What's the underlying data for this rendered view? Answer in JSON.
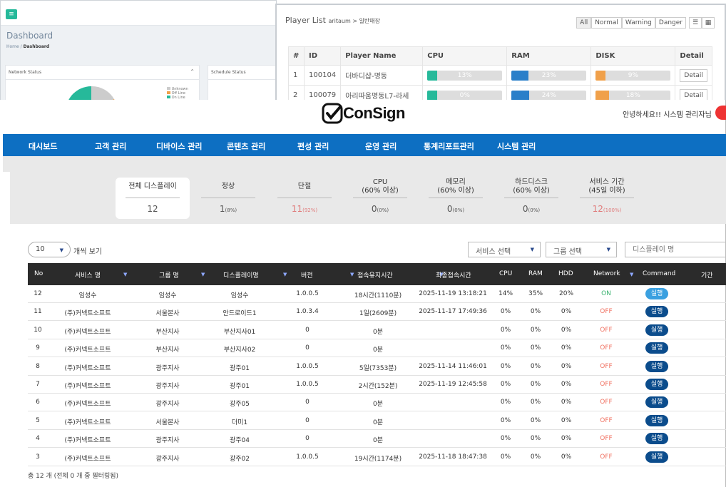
{
  "bg_dashboard": {
    "title": "Dashboard",
    "crumb_home": "Home",
    "crumb_sep": "/",
    "crumb_current": "Dashboard",
    "network_panel": "Network Status",
    "schedule_panel": "Schedule Status",
    "legend": [
      "Unknown",
      "Off Line",
      "On Line"
    ]
  },
  "bg_player": {
    "title": "Player List",
    "breadcrumb": "aritaum > 일반매장",
    "filters": [
      "All",
      "Normal",
      "Warning",
      "Danger"
    ],
    "columns": [
      "#",
      "ID",
      "Player Name",
      "CPU",
      "RAM",
      "DISK",
      "Detail"
    ],
    "rows": [
      {
        "n": "1",
        "id": "100104",
        "name": "더바디샵-명동",
        "cpu": "13%",
        "cpu_v": 13,
        "ram": "23%",
        "ram_v": 23,
        "disk": "9%",
        "disk_v": 9,
        "detail": "Detail"
      },
      {
        "n": "2",
        "id": "100079",
        "name": "아리따움명동L7-라세",
        "cpu": "0%",
        "cpu_v": 0,
        "ram": "24%",
        "ram_v": 24,
        "disk": "18%",
        "disk_v": 18,
        "detail": "Detail"
      }
    ]
  },
  "header": {
    "logo": "ConSign",
    "greeting": "안녕하세요!! 시스템 관리자님"
  },
  "nav": [
    "대시보드",
    "고객 관리",
    "디바이스 관리",
    "콘텐츠 관리",
    "편성 관리",
    "운영 관리",
    "통계리포트관리",
    "시스템 관리"
  ],
  "cards": [
    {
      "title": "전체 디스플레이",
      "value": "12",
      "pct": ""
    },
    {
      "title": "정상",
      "value": "1",
      "pct": "(8%)"
    },
    {
      "title": "단절",
      "value": "11",
      "pct": "(92%)"
    },
    {
      "title": "CPU\n(60% 이상)",
      "value": "0",
      "pct": "(0%)"
    },
    {
      "title": "메모리\n(60% 이상)",
      "value": "0",
      "pct": "(0%)"
    },
    {
      "title": "하드디스크\n(60% 이상)",
      "value": "0",
      "pct": "(0%)"
    },
    {
      "title": "서비스 기간\n(45일 이하)",
      "value": "12",
      "pct": "(100%)"
    }
  ],
  "controls": {
    "page_size": "10",
    "page_size_label": "개씩 보기",
    "service_select": "서비스 선택",
    "group_select": "그룹 선택",
    "search_placeholder": "디스플레이 명"
  },
  "table": {
    "columns": [
      "No",
      "서비스 명",
      "그룹 명",
      "디스플레이명",
      "버전",
      "접속유지시간",
      "최종접속시간",
      "CPU",
      "RAM",
      "HDD",
      "Network",
      "Command",
      "기간"
    ],
    "rows": [
      {
        "no": "12",
        "service": "임성수",
        "group": "임성수",
        "display": "임성수",
        "version": "1.0.0.5",
        "uptime": "18시간(1110분)",
        "last": "2025-11-19 13:18:21",
        "cpu": "14%",
        "ram": "35%",
        "hdd": "20%",
        "net": "ON",
        "cmd": "실행"
      },
      {
        "no": "11",
        "service": "(주)커넥트소프트",
        "group": "서울본사",
        "display": "안드로이드1",
        "version": "1.0.3.4",
        "uptime": "1일(2609분)",
        "last": "2025-11-17 17:49:36",
        "cpu": "0%",
        "ram": "0%",
        "hdd": "0%",
        "net": "OFF",
        "cmd": "실행"
      },
      {
        "no": "10",
        "service": "(주)커넥트소프트",
        "group": "부산지사",
        "display": "부산지사01",
        "version": "0",
        "uptime": "0분",
        "last": "",
        "cpu": "0%",
        "ram": "0%",
        "hdd": "0%",
        "net": "OFF",
        "cmd": "실행"
      },
      {
        "no": "9",
        "service": "(주)커넥트소프트",
        "group": "부산지사",
        "display": "부산지사02",
        "version": "0",
        "uptime": "0분",
        "last": "",
        "cpu": "0%",
        "ram": "0%",
        "hdd": "0%",
        "net": "OFF",
        "cmd": "실행"
      },
      {
        "no": "8",
        "service": "(주)커넥트소프트",
        "group": "광주지사",
        "display": "광주01",
        "version": "1.0.0.5",
        "uptime": "5일(7353분)",
        "last": "2025-11-14 11:46:01",
        "cpu": "0%",
        "ram": "0%",
        "hdd": "0%",
        "net": "OFF",
        "cmd": "실행"
      },
      {
        "no": "7",
        "service": "(주)커넥트소프트",
        "group": "광주지사",
        "display": "광주01",
        "version": "1.0.0.5",
        "uptime": "2시간(152분)",
        "last": "2025-11-19 12:45:58",
        "cpu": "0%",
        "ram": "0%",
        "hdd": "0%",
        "net": "OFF",
        "cmd": "실행"
      },
      {
        "no": "6",
        "service": "(주)커넥트소프트",
        "group": "광주지사",
        "display": "광주05",
        "version": "0",
        "uptime": "0분",
        "last": "",
        "cpu": "0%",
        "ram": "0%",
        "hdd": "0%",
        "net": "OFF",
        "cmd": "실행"
      },
      {
        "no": "5",
        "service": "(주)커넥트소프트",
        "group": "서울본사",
        "display": "더미1",
        "version": "0",
        "uptime": "0분",
        "last": "",
        "cpu": "0%",
        "ram": "0%",
        "hdd": "0%",
        "net": "OFF",
        "cmd": "실행"
      },
      {
        "no": "4",
        "service": "(주)커넥트소프트",
        "group": "광주지사",
        "display": "광주04",
        "version": "0",
        "uptime": "0분",
        "last": "",
        "cpu": "0%",
        "ram": "0%",
        "hdd": "0%",
        "net": "OFF",
        "cmd": "실행"
      },
      {
        "no": "3",
        "service": "(주)커넥트소프트",
        "group": "광주지사",
        "display": "광주02",
        "version": "1.0.0.5",
        "uptime": "19시간(1174분)",
        "last": "2025-11-18 18:47:38",
        "cpu": "0%",
        "ram": "0%",
        "hdd": "0%",
        "net": "OFF",
        "cmd": "실행"
      }
    ]
  },
  "footer": "총 12 개 (전체 0 개 중 필터링됨)",
  "colors": {
    "nav": "#0d6fc2",
    "table_header": "#2b2b2b",
    "on": "#3cb371",
    "off": "#f07060",
    "exec_button": "#0b4c8c",
    "cpu_bar": "#26b99a",
    "ram_bar": "#2a7fc9",
    "disk_bar": "#f0a04a"
  }
}
